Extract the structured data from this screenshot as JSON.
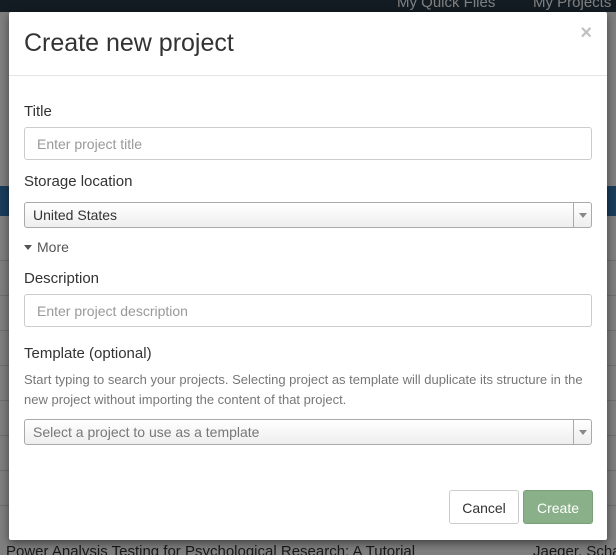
{
  "background": {
    "nav_links": [
      "My Quick Files",
      "My Projects"
    ],
    "bottom_left_text": "Power Analysis Testing for Psychological Research: A Tutorial",
    "bottom_right_text": "Jaeger, Schab"
  },
  "modal": {
    "title": "Create new project",
    "close_symbol": "×",
    "title_field": {
      "label": "Title",
      "placeholder": "Enter project title",
      "value": ""
    },
    "storage": {
      "label": "Storage location",
      "selected": "United States"
    },
    "more_label": "More",
    "description_field": {
      "label": "Description",
      "placeholder": "Enter project description",
      "value": ""
    },
    "template": {
      "label": "Template (optional)",
      "help": "Start typing to search your projects. Selecting project as template will duplicate its structure in the new project without importing the content of that project.",
      "placeholder": "Select a project to use as a template"
    },
    "buttons": {
      "cancel": "Cancel",
      "create": "Create"
    }
  },
  "colors": {
    "create_button": "#89b089",
    "navbar": "#263947",
    "highlight_strip": "#337ab7"
  }
}
